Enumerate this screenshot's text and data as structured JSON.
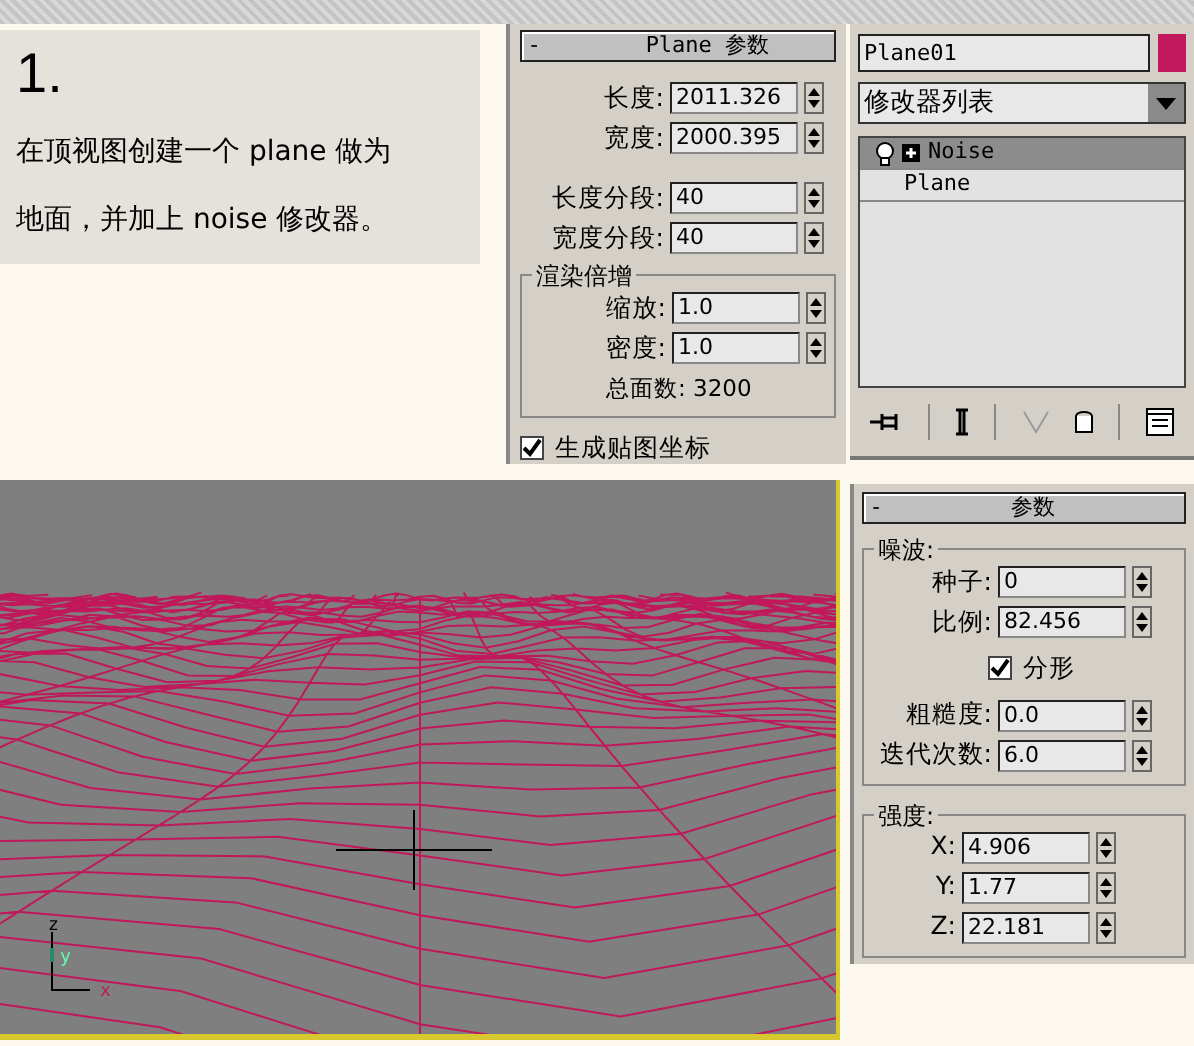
{
  "step": {
    "number": "1.",
    "text": "在顶视图创建一个 plane 做为地面，并加上 noise 修改器。"
  },
  "plane_params": {
    "collapse": "-",
    "title": "Plane 参数",
    "size_fields": [
      {
        "label": "长度:",
        "value": "2011.326"
      },
      {
        "label": "宽度:",
        "value": "2000.395"
      }
    ],
    "segment_fields": [
      {
        "label": "长度分段:",
        "value": "40"
      },
      {
        "label": "宽度分段:",
        "value": "40"
      }
    ],
    "group": {
      "title": "渲染倍增",
      "fields": [
        {
          "label": "缩放:",
          "value": "1.0"
        },
        {
          "label": "密度:",
          "value": "1.0"
        }
      ],
      "total": "总面数: 3200"
    },
    "checkbox": {
      "label": "生成贴图坐标",
      "checked": true
    }
  },
  "modifier_panel": {
    "name": "Plane01",
    "color": "#c0185a",
    "dropdown": "修改器列表",
    "stack": [
      {
        "label": "Noise",
        "kind": "modifier",
        "selected": true
      },
      {
        "label": "Plane",
        "kind": "object",
        "selected": false
      }
    ]
  },
  "viewport": {
    "axis_labels": [
      "z",
      "y",
      "x"
    ]
  },
  "noise_params": {
    "collapse": "-",
    "title": "参数",
    "groups": [
      {
        "title": "噪波:",
        "rows": [
          {
            "kind": "field",
            "label": "种子:",
            "value": "0"
          },
          {
            "kind": "field",
            "label": "比例:",
            "value": "82.456"
          },
          {
            "kind": "checkbox",
            "label": "分形",
            "checked": true
          },
          {
            "kind": "field",
            "label": "粗糙度:",
            "value": "0.0"
          },
          {
            "kind": "field",
            "label": "迭代次数:",
            "value": "6.0"
          }
        ]
      },
      {
        "title": "强度:",
        "rows": [
          {
            "kind": "field",
            "label": "X:",
            "value": "4.906"
          },
          {
            "kind": "field",
            "label": "Y:",
            "value": "1.77"
          },
          {
            "kind": "field",
            "label": "Z:",
            "value": "22.181"
          }
        ]
      }
    ]
  }
}
